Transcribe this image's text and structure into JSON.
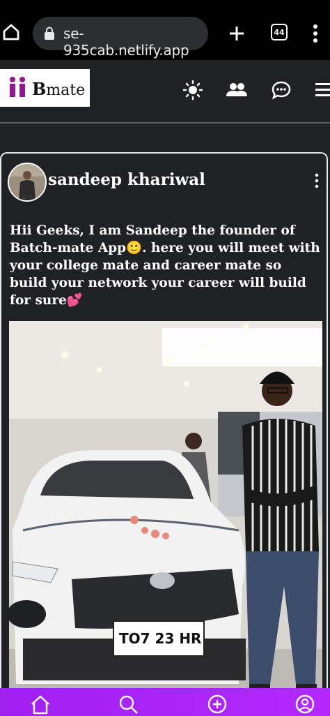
{
  "browser": {
    "url": "se-935cab.netlify.app",
    "tab_count": "44",
    "icons": [
      "home-icon",
      "lock-icon",
      "plus-icon",
      "tabs-icon",
      "more-vert-icon"
    ]
  },
  "app": {
    "logo_text_b": "B",
    "logo_text_rest": "mate",
    "header_icons": [
      "sun-icon",
      "people-icon",
      "chat-icon",
      "hamburger-icon"
    ]
  },
  "post": {
    "author": "sandeep khariwal",
    "text": "Hii Geeks, I am Sandeep the founder of Batch-mate App🙂. here you will meet with your college mate and career mate so build your network your career will build for sure💕",
    "image_plate": "TO7 23 HR"
  },
  "bottom_nav": {
    "icons": [
      "home-icon",
      "search-icon",
      "add-circle-icon",
      "profile-icon"
    ]
  },
  "colors": {
    "background": "#202124",
    "browser_bar": "#000000",
    "nav_gradient": "#a020f0",
    "logo_purple": "#8e1a8e"
  }
}
